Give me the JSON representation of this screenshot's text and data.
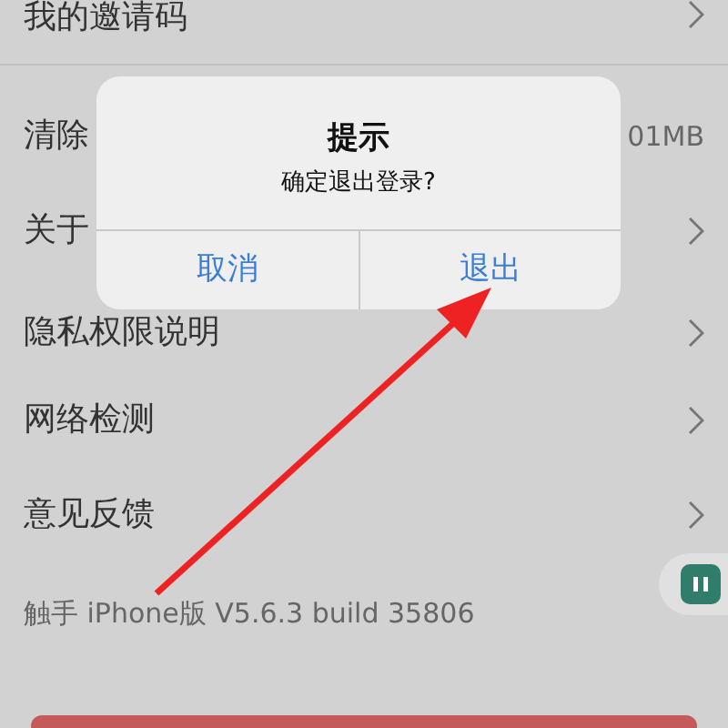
{
  "settings": [
    {
      "label": "我的邀请码",
      "kind": "link"
    },
    {
      "label": "清除",
      "kind": "value",
      "value": "01MB"
    },
    {
      "label": "关于",
      "kind": "link"
    },
    {
      "label": "隐私权限说明",
      "kind": "link"
    },
    {
      "label": "网络检测",
      "kind": "link"
    },
    {
      "label": "意见反馈",
      "kind": "link"
    }
  ],
  "version": "触手 iPhone版 V5.6.3 build 35806",
  "dialog": {
    "title": "提示",
    "message": "确定退出登录?",
    "buttons": [
      "取消",
      "退出"
    ]
  }
}
